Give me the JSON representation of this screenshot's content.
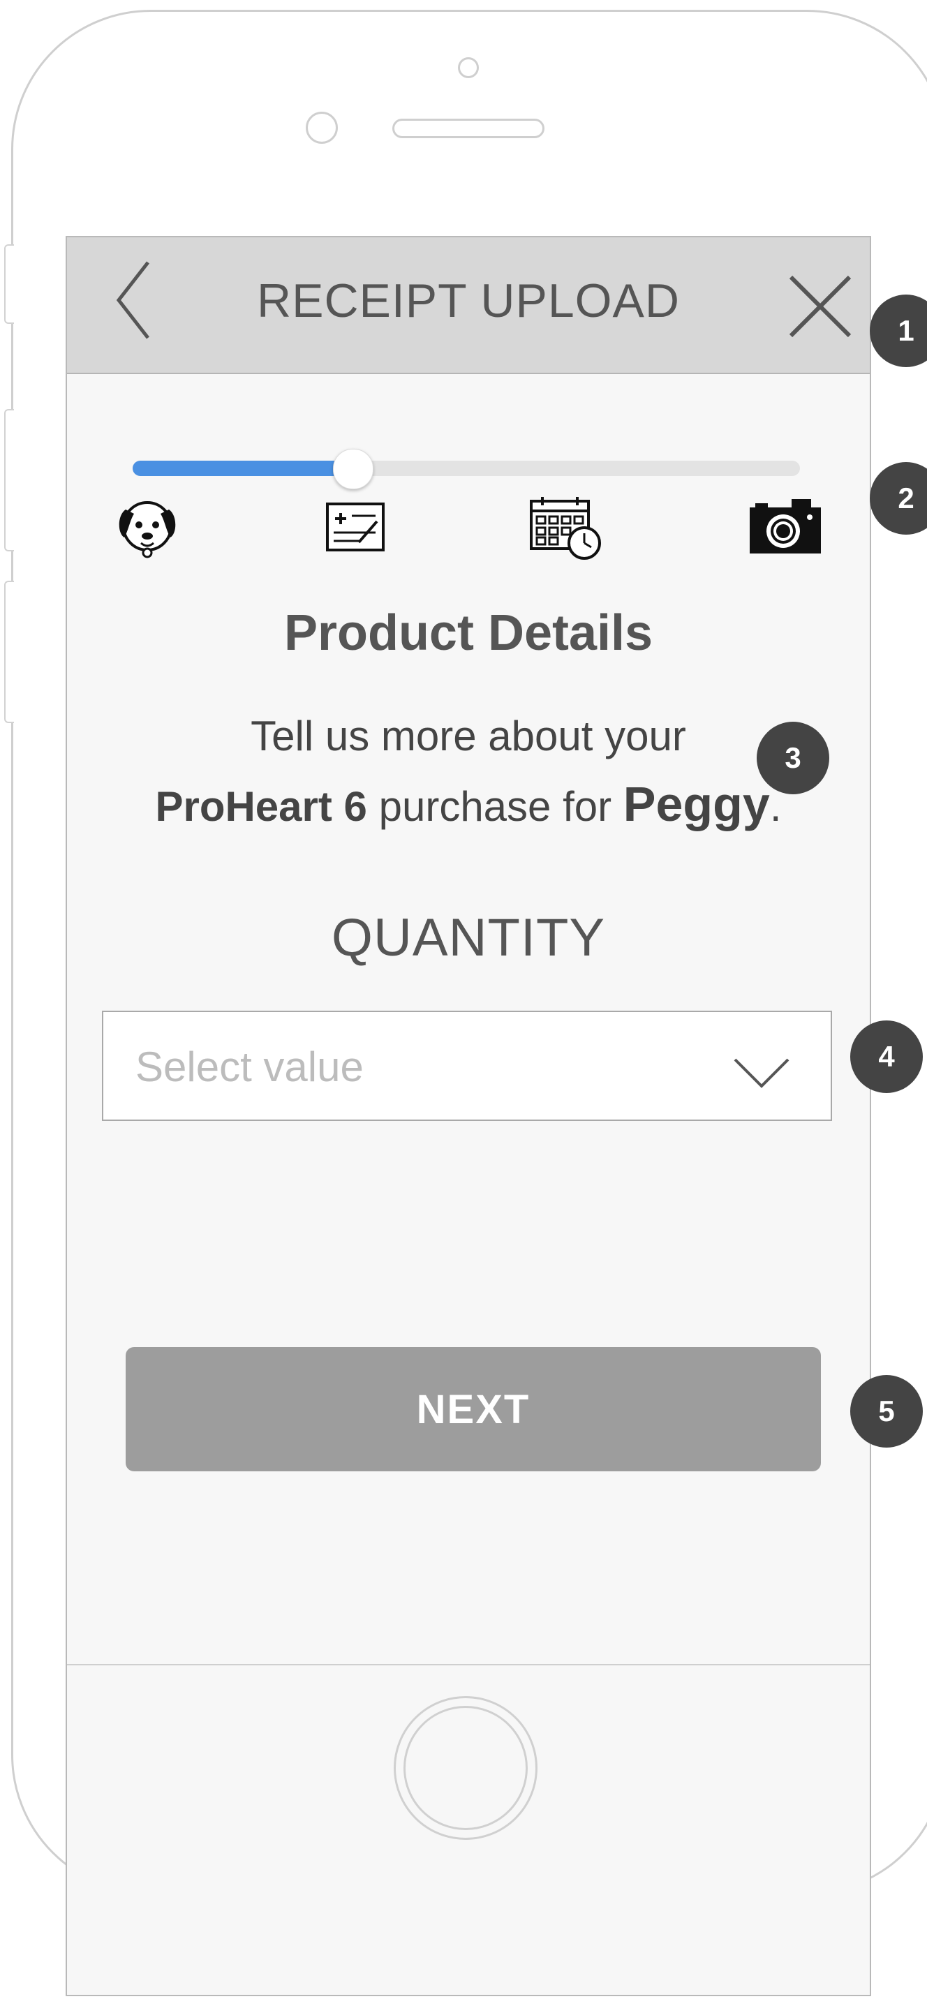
{
  "header": {
    "title": "RECEIPT UPLOAD",
    "back_icon": "chevron-left-icon",
    "close_icon": "close-icon"
  },
  "progress": {
    "value": 0.33,
    "steps": [
      {
        "icon": "dog-icon"
      },
      {
        "icon": "prescription-icon"
      },
      {
        "icon": "calendar-clock-icon"
      },
      {
        "icon": "camera-icon"
      }
    ]
  },
  "main": {
    "heading": "Product Details",
    "description_line1": "Tell us more about your",
    "product_name": "ProHeart 6",
    "description_mid": "purchase for",
    "pet_name": "Peggy",
    "description_end": ".",
    "quantity_label": "QUANTITY",
    "quantity_select": {
      "placeholder": "Select value",
      "icon": "chevron-down-icon"
    },
    "next_label": "NEXT"
  },
  "annotations": [
    "1",
    "2",
    "3",
    "4",
    "5"
  ],
  "colors": {
    "accent": "#4a90e2",
    "header_bg": "#d7d7d7",
    "button_bg": "#9d9d9d",
    "badge_bg": "#444444"
  }
}
